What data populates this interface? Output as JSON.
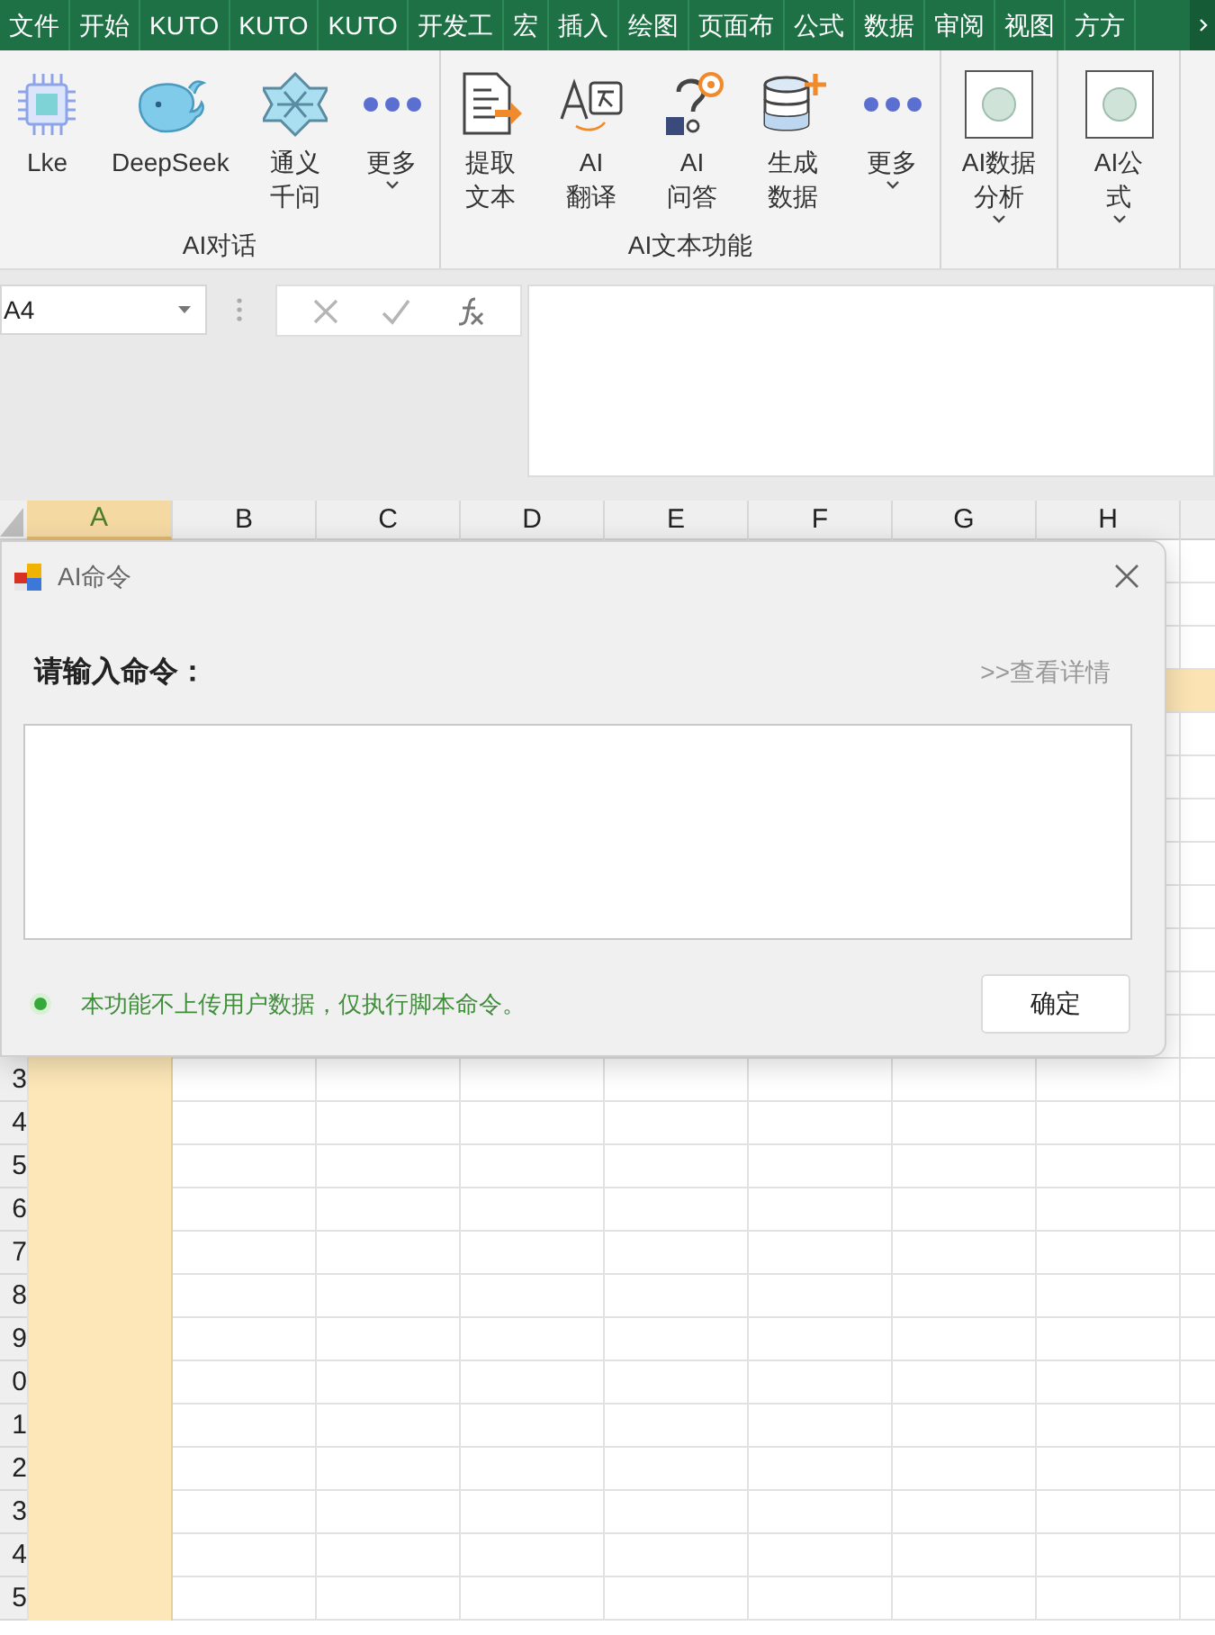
{
  "ribbon_tabs": [
    {
      "label": "文件"
    },
    {
      "label": "开始"
    },
    {
      "label": "KUTO"
    },
    {
      "label": "KUTO"
    },
    {
      "label": "KUTO"
    },
    {
      "label": "开发工"
    },
    {
      "label": "宏"
    },
    {
      "label": "插入"
    },
    {
      "label": "绘图"
    },
    {
      "label": "页面布"
    },
    {
      "label": "公式"
    },
    {
      "label": "数据"
    },
    {
      "label": "审阅"
    },
    {
      "label": "视图"
    },
    {
      "label": "方方"
    }
  ],
  "ribbon_groups": [
    {
      "label": "AI对话",
      "buttons": [
        {
          "kind": "chip",
          "lines": [
            "Lke"
          ],
          "dropdown": false
        },
        {
          "kind": "whale",
          "lines": [
            "DeepSeek"
          ],
          "dropdown": false
        },
        {
          "kind": "star",
          "lines": [
            "通义",
            "千问"
          ],
          "dropdown": false
        },
        {
          "kind": "dots",
          "lines": [
            "更多"
          ],
          "dropdown": true
        }
      ]
    },
    {
      "label": "AI文本功能",
      "buttons": [
        {
          "kind": "doc",
          "lines": [
            "提取",
            "文本"
          ],
          "dropdown": false
        },
        {
          "kind": "translate",
          "lines": [
            "AI",
            "翻译"
          ],
          "dropdown": false
        },
        {
          "kind": "qa",
          "lines": [
            "AI",
            "问答"
          ],
          "dropdown": false
        },
        {
          "kind": "database",
          "lines": [
            "生成",
            "数据"
          ],
          "dropdown": false
        },
        {
          "kind": "dots",
          "lines": [
            "更多"
          ],
          "dropdown": true
        }
      ]
    },
    {
      "buttons": [
        {
          "kind": "swatch",
          "lines": [
            "AI数据",
            "分析"
          ],
          "dropdown": true
        }
      ]
    },
    {
      "buttons": [
        {
          "kind": "swatch",
          "lines": [
            "AI公",
            "式"
          ],
          "dropdown": true
        }
      ]
    }
  ],
  "name_box": "A4",
  "columns": [
    {
      "label": "A",
      "selected": true
    },
    {
      "label": "B",
      "selected": false
    },
    {
      "label": "C",
      "selected": false
    },
    {
      "label": "D",
      "selected": false
    },
    {
      "label": "E",
      "selected": false
    },
    {
      "label": "F",
      "selected": false
    },
    {
      "label": "G",
      "selected": false
    },
    {
      "label": "H",
      "selected": false
    }
  ],
  "active_row_highlight": true,
  "row_headers": [
    "3",
    "4",
    "5",
    "6",
    "7",
    "8",
    "9",
    "0",
    "1",
    "2",
    "3",
    "4",
    "5"
  ],
  "dialog": {
    "title": "AI命令",
    "prompt_label": "请输入命令：",
    "details_link": ">>查看详情",
    "notice": "本功能不上传用户数据，仅执行脚本命令。",
    "confirm_button": "确定"
  }
}
